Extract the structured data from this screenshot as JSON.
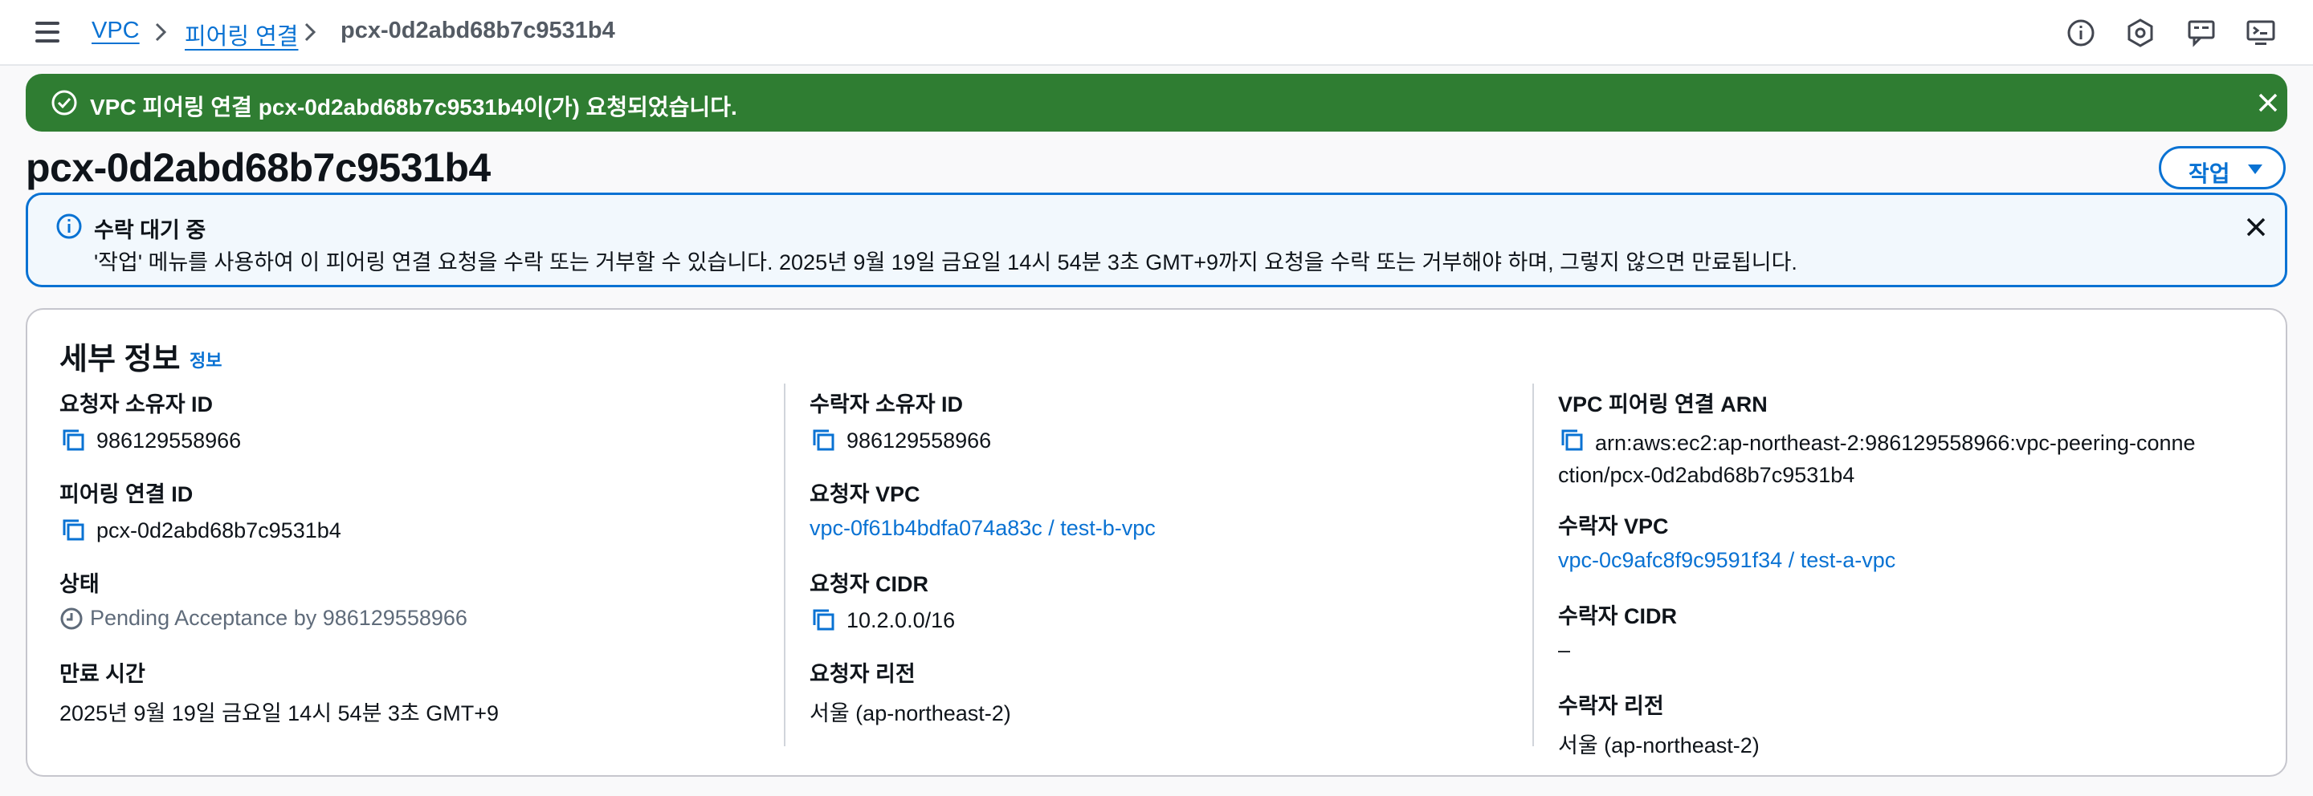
{
  "breadcrumb": {
    "items": [
      "VPC",
      "피어링 연결"
    ],
    "current": "pcx-0d2abd68b7c9531b4"
  },
  "top_icons": [
    "info-icon",
    "settings-hex-icon",
    "feedback-icon",
    "console-icon"
  ],
  "flash": {
    "prefix": "VPC 피어링 연결 ",
    "id": "pcx-0d2abd68b7c9531b4",
    "suffix": "이(가) 요청되었습니다.",
    "color": "#2f7d32"
  },
  "page": {
    "title": "pcx-0d2abd68b7c9531b4",
    "action_label": "작업"
  },
  "alert": {
    "title": "수락 대기 중",
    "body": "'작업' 메뉴를 사용하여 이 피어링 연결 요청을 수락 또는 거부할 수 있습니다. 2025년 9월 19일 금요일 14시 54분 3초 GMT+9까지 요청을 수락 또는 거부해야 하며, 그렇지 않으면 만료됩니다."
  },
  "details": {
    "title": "세부 정보",
    "info_link": "정보",
    "col1": {
      "requester_owner": {
        "label": "요청자 소유자 ID",
        "value": "986129558966"
      },
      "peering_id": {
        "label": "피어링 연결 ID",
        "value": "pcx-0d2abd68b7c9531b4"
      },
      "status": {
        "label": "상태",
        "value": "Pending Acceptance by 986129558966"
      },
      "expiration": {
        "label": "만료 시간",
        "value": "2025년 9월 19일 금요일 14시 54분 3초 GMT+9"
      }
    },
    "col2": {
      "accepter_owner": {
        "label": "수락자 소유자 ID",
        "value": "986129558966"
      },
      "requester_vpc": {
        "label": "요청자 VPC",
        "value": "vpc-0f61b4bdfa074a83c / test-b-vpc"
      },
      "requester_cidr": {
        "label": "요청자 CIDR",
        "value": "10.2.0.0/16"
      },
      "requester_region": {
        "label": "요청자 리전",
        "value": "서울 (ap-northeast-2)"
      }
    },
    "col3": {
      "arn": {
        "label": "VPC 피어링 연결 ARN",
        "value": "arn:aws:ec2:ap-northeast-2:986129558966:vpc-peering-connection/pcx-0d2abd68b7c9531b4"
      },
      "accepter_vpc": {
        "label": "수락자 VPC",
        "value": "vpc-0c9afc8f9c9591f34 / test-a-vpc"
      },
      "accepter_cidr": {
        "label": "수락자 CIDR",
        "value": "–"
      },
      "accepter_region": {
        "label": "수락자 리전",
        "value": "서울 (ap-northeast-2)"
      }
    }
  },
  "colors": {
    "link": "#0972d3",
    "success": "#2f7d32",
    "info_bg": "#f2f8fd"
  }
}
